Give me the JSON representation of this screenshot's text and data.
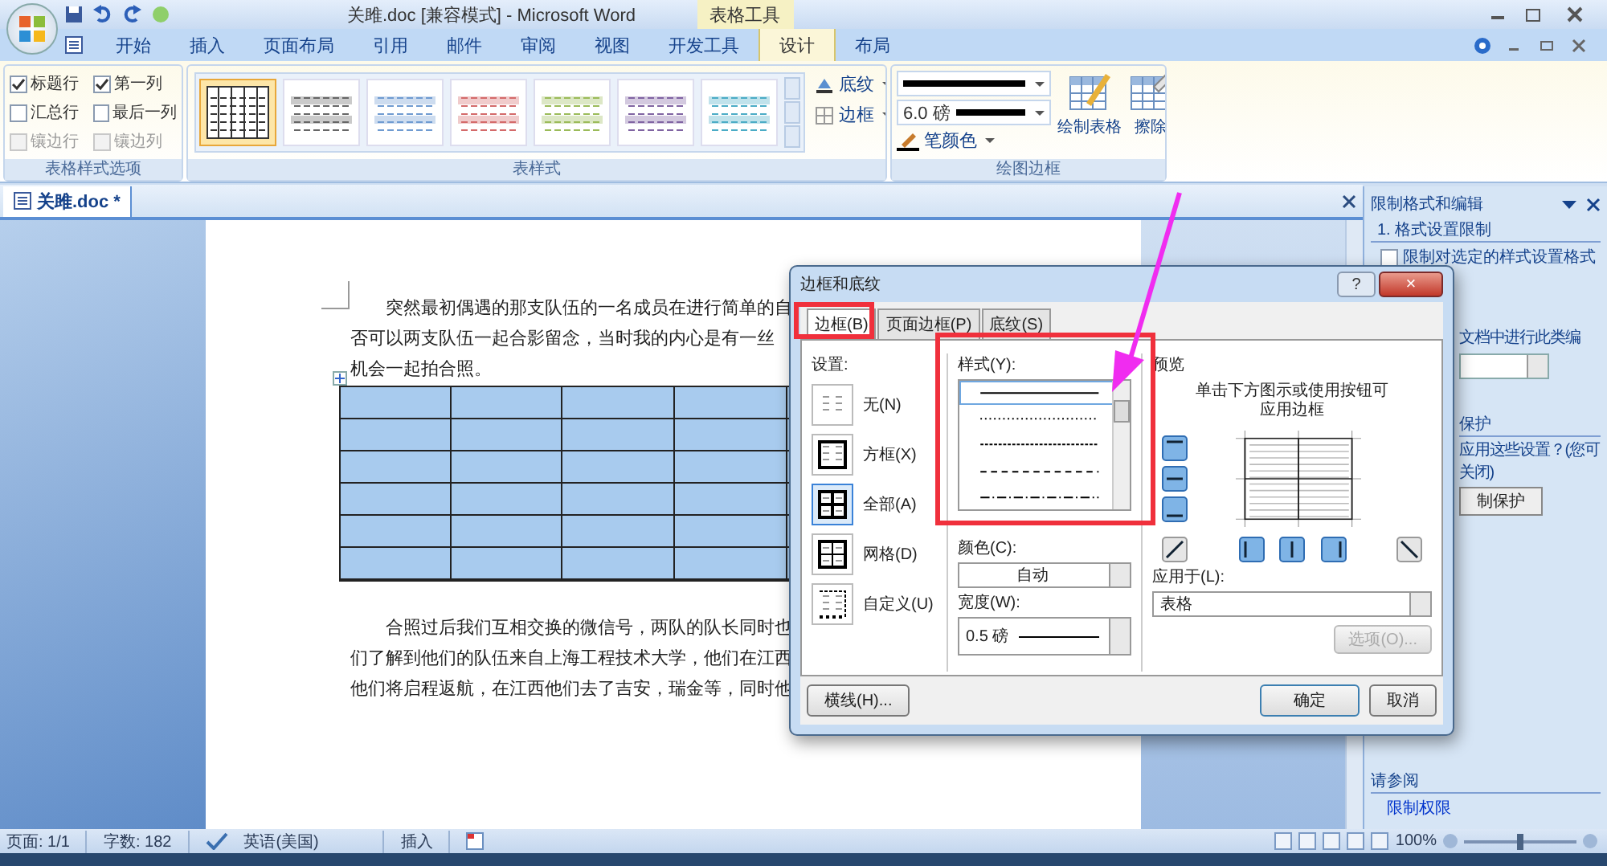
{
  "title_bar": {
    "title": "关雎.doc [兼容模式] - Microsoft Word",
    "context_tab": "表格工具"
  },
  "ribbon_tabs": [
    {
      "label": "开始",
      "selected": false
    },
    {
      "label": "插入",
      "selected": false
    },
    {
      "label": "页面布局",
      "selected": false
    },
    {
      "label": "引用",
      "selected": false
    },
    {
      "label": "邮件",
      "selected": false
    },
    {
      "label": "审阅",
      "selected": false
    },
    {
      "label": "视图",
      "selected": false
    },
    {
      "label": "开发工具",
      "selected": false
    },
    {
      "label": "设计",
      "selected": true
    },
    {
      "label": "布局",
      "selected": false
    }
  ],
  "table_style_options": {
    "label": "表格样式选项",
    "options": [
      {
        "label": "标题行",
        "checked": true,
        "disabled": false
      },
      {
        "label": "第一列",
        "checked": true,
        "disabled": false
      },
      {
        "label": "汇总行",
        "checked": false,
        "disabled": false
      },
      {
        "label": "最后一列",
        "checked": false,
        "disabled": false
      },
      {
        "label": "镶边行",
        "checked": false,
        "disabled": true
      },
      {
        "label": "镶边列",
        "checked": false,
        "disabled": true
      }
    ]
  },
  "table_styles": {
    "label": "表样式",
    "styles": [
      {
        "color": "#333333",
        "selected": true
      },
      {
        "color": "#666666",
        "selected": false
      },
      {
        "color": "#6f9bd1",
        "selected": false
      },
      {
        "color": "#d46a6a",
        "selected": false
      },
      {
        "color": "#9bbb59",
        "selected": false
      },
      {
        "color": "#8064a2",
        "selected": false
      },
      {
        "color": "#4bacc6",
        "selected": false
      }
    ],
    "shading": "底纹",
    "borders": "边框"
  },
  "draw_borders": {
    "label": "绘图边框",
    "line_weight": "6.0 磅",
    "pen_color": "笔颜色",
    "draw_table": "绘制表格",
    "eraser": "擦除"
  },
  "document_tab": {
    "label": "关雎.doc *"
  },
  "document": {
    "paragraphs": [
      {
        "lines": [
          "突然最初偶遇的那支队伍的一名成员在进行简单的自",
          "否可以两支队伍一起合影留念，当时我的内心是有一丝",
          "机会一起拍合照。"
        ]
      },
      {
        "lines": [
          "合照过后我们互相交换的微信号，两队的队长同时也",
          "们了解到他们的队伍来自上海工程技术大学，他们在江西",
          "他们将启程返航，在江西他们去了吉安，瑞金等，同时他"
        ]
      }
    ]
  },
  "task_pane": {
    "title": "限制格式和编辑",
    "section_1": "1. 格式设置限制",
    "limit_checkbox": {
      "label": "限制对选定的样式设置格式",
      "checked": false
    },
    "section_2_text": "文档中进行此类编",
    "section_3": "保护",
    "section_3_text": [
      "应用这些设置？(您可",
      "关闭)"
    ],
    "enforce_button": "制保护",
    "see_also": "请参阅",
    "permission_link": "限制权限"
  },
  "status_bar": {
    "page": "页面: 1/1",
    "words": "字数: 182",
    "language": "英语(美国)",
    "mode": "插入",
    "zoom": "100%",
    "zoom_slider": {
      "level": 0.5
    }
  },
  "dialog": {
    "title": "边框和底纹",
    "help": "?",
    "close": "×",
    "tabs": [
      {
        "label": "边框(B)",
        "selected": true
      },
      {
        "label": "页面边框(P)",
        "selected": false
      },
      {
        "label": "底纹(S)",
        "selected": false
      }
    ],
    "settings": {
      "label": "设置:",
      "items": [
        {
          "kind": "none",
          "label": "无(N)",
          "selected": false
        },
        {
          "kind": "box",
          "label": "方框(X)",
          "selected": false
        },
        {
          "kind": "all",
          "label": "全部(A)",
          "selected": true
        },
        {
          "kind": "grid",
          "label": "网格(D)",
          "selected": false
        },
        {
          "kind": "custom",
          "label": "自定义(U)",
          "selected": false
        }
      ]
    },
    "style": {
      "label": "样式(Y):",
      "lines": [
        {
          "kind": "solid",
          "selected": true
        },
        {
          "kind": "dotted",
          "selected": false
        },
        {
          "kind": "fine",
          "selected": false
        },
        {
          "kind": "dashed",
          "selected": false
        },
        {
          "kind": "dashdot",
          "selected": false
        }
      ]
    },
    "color": {
      "label": "颜色(C):",
      "value": "自动"
    },
    "width": {
      "label": "宽度(W):",
      "value": "0.5 磅"
    },
    "preview": {
      "label": "预览",
      "hint": "单击下方图示或使用按钮可应用边框"
    },
    "preview_buttons": [
      {
        "kind": "top",
        "on": true
      },
      {
        "kind": "middle",
        "on": true
      },
      {
        "kind": "bottom",
        "on": true
      },
      {
        "kind": "diag-up",
        "on": false
      },
      {
        "kind": "left",
        "on": true
      },
      {
        "kind": "center",
        "on": true
      },
      {
        "kind": "right",
        "on": true
      },
      {
        "kind": "diag-down",
        "on": false
      }
    ],
    "apply_to": {
      "label": "应用于(L):",
      "value": "表格"
    },
    "options_button": {
      "label": "选项(O)...",
      "disabled": true
    },
    "horizontal_line_button": "横线(H)...",
    "ok": "确定",
    "cancel": "取消"
  }
}
